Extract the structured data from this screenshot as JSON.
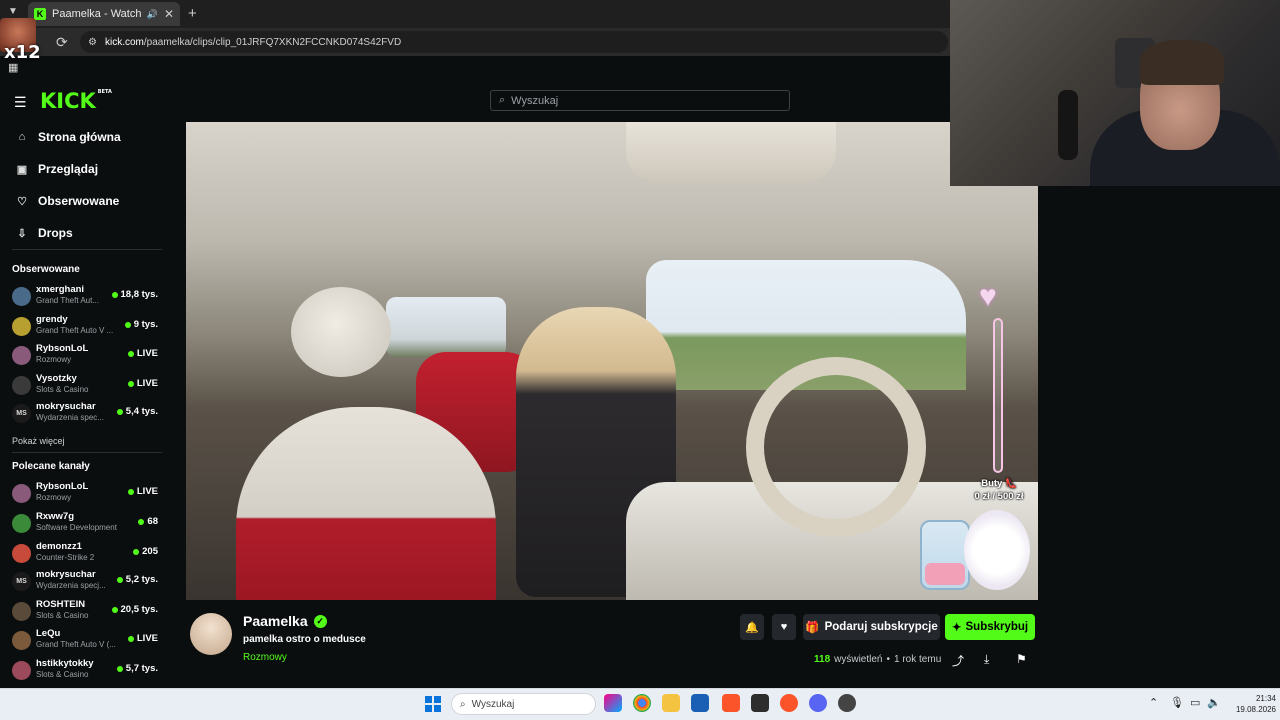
{
  "browser": {
    "tab_title": "Paamelka - Watch clips on",
    "favicon_letter": "K",
    "url_host": "kick.com",
    "url_path": "/paamelka/clips/clip_01JRFQ7XKN2FCCNKD074S42FVD",
    "overlay_logo_text": "x12"
  },
  "header": {
    "logo": "KICK",
    "logo_badge": "BETA",
    "search_placeholder": "Wyszukaj"
  },
  "sidebar": {
    "nav": [
      {
        "label": "Strona główna",
        "icon": "home-icon"
      },
      {
        "label": "Przeglądaj",
        "icon": "browse-icon"
      },
      {
        "label": "Obserwowane",
        "icon": "heart-icon"
      },
      {
        "label": "Drops",
        "icon": "drops-icon"
      }
    ],
    "followed_title": "Obserwowane",
    "followed": [
      {
        "name": "xmerghani",
        "category": "Grand Theft Aut...",
        "viewers": "18,8 tys.",
        "color": "#4a6a8a"
      },
      {
        "name": "grendy",
        "category": "Grand Theft Auto V ...",
        "viewers": "9 tys.",
        "color": "#b8a030"
      },
      {
        "name": "RybsonLoL",
        "category": "Rozmowy",
        "viewers": "LIVE",
        "color": "#8a5a7a"
      },
      {
        "name": "Vysotzky",
        "category": "Slots & Casino",
        "viewers": "LIVE",
        "color": "#3a3a3a"
      },
      {
        "name": "mokrysuchar",
        "category": "Wydarzenia spec...",
        "viewers": "5,4 tys.",
        "color": "#1a1a1a",
        "initials": "MS"
      }
    ],
    "show_more": "Pokaż więcej",
    "recommended_title": "Polecane kanały",
    "recommended": [
      {
        "name": "RybsonLoL",
        "category": "Rozmowy",
        "viewers": "LIVE",
        "color": "#8a5a7a"
      },
      {
        "name": "Rxww7g",
        "category": "Software Development",
        "viewers": "68",
        "color": "#3a8a3a"
      },
      {
        "name": "demonzz1",
        "category": "Counter-Strike 2",
        "viewers": "205",
        "color": "#c84a3a"
      },
      {
        "name": "mokrysuchar",
        "category": "Wydarzenia specj...",
        "viewers": "5,2 tys.",
        "color": "#1a1a1a",
        "initials": "MS"
      },
      {
        "name": "ROSHTEIN",
        "category": "Slots & Casino",
        "viewers": "20,5 tys.",
        "color": "#5a4a3a"
      },
      {
        "name": "LeQu",
        "category": "Grand Theft Auto V (...",
        "viewers": "LIVE",
        "color": "#7a5a3a"
      },
      {
        "name": "hstikkytokky",
        "category": "Slots & Casino",
        "viewers": "5,7 tys.",
        "color": "#9a4a5a"
      }
    ]
  },
  "overlay": {
    "goal_label": "Buty 👠",
    "goal_amount": "0 zł / 500 zł",
    "goal_progress": 0.0
  },
  "clip": {
    "streamer": "Paamelka",
    "title": "pamelka ostro o medusce",
    "category": "Rozmowy",
    "gift_label": "Podaruj subskrypcje",
    "subscribe_label": "Subskrybuj",
    "views_count": "118",
    "views_label": "wyświetleń",
    "age": "1 rok temu"
  },
  "taskbar": {
    "search_placeholder": "Wyszukaj",
    "time": "21:34",
    "date": "19.08.2026"
  }
}
